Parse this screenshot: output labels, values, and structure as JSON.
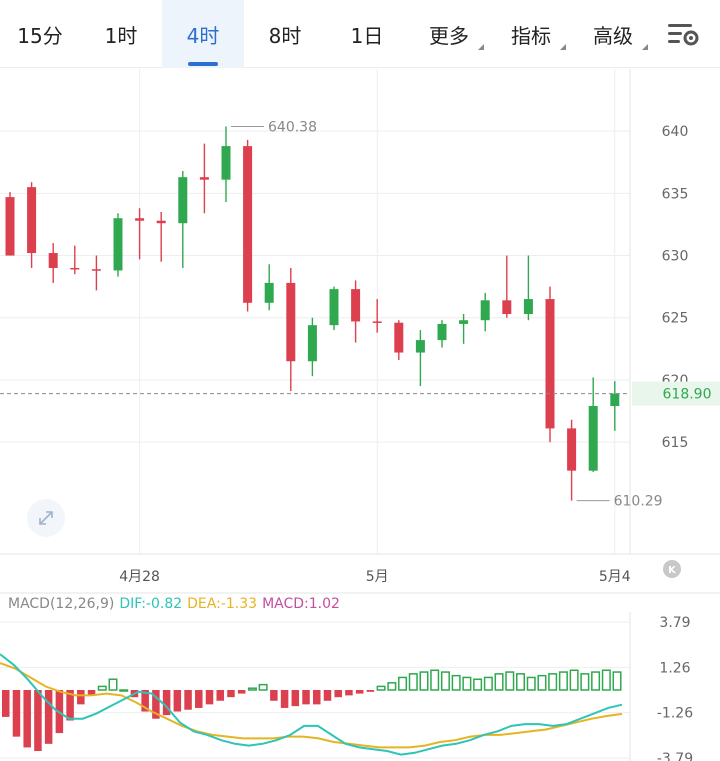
{
  "tabs": [
    {
      "label": "15分",
      "active": false,
      "dropdown": false
    },
    {
      "label": "1时",
      "active": false,
      "dropdown": false
    },
    {
      "label": "4时",
      "active": true,
      "dropdown": false
    },
    {
      "label": "8时",
      "active": false,
      "dropdown": false
    },
    {
      "label": "1日",
      "active": false,
      "dropdown": false
    },
    {
      "label": "更多",
      "active": false,
      "dropdown": true
    },
    {
      "label": "指标",
      "active": false,
      "dropdown": true
    },
    {
      "label": "高级",
      "active": false,
      "dropdown": true
    }
  ],
  "settings_icon": "chart-settings-icon",
  "zoom_icon": "expand-icon",
  "kline_badge": "K",
  "colors": {
    "up": "#2fa84f",
    "down": "#dc3f4d",
    "dif": "#2ec4b6",
    "dea": "#e6b422",
    "macd": "#c44fa0",
    "accent": "#2d6fd0",
    "grid": "#eeeeee",
    "price_badge_bg": "#e8f6ec",
    "price_badge_text": "#2fa84f"
  },
  "chart_data": [
    {
      "type": "candlestick",
      "ylim": [
        606,
        645
      ],
      "yticks": [
        615,
        620,
        625,
        630,
        635,
        640
      ],
      "x_labels": [
        {
          "label": "4月28",
          "index": 6
        },
        {
          "label": "5月",
          "index": 17
        },
        {
          "label": "5月4",
          "index": 28
        }
      ],
      "current_price": "618.90",
      "max_label": "640.38",
      "min_label": "610.29",
      "candles": [
        {
          "o": 634.7,
          "h": 635.1,
          "l": 630.0,
          "c": 630.0
        },
        {
          "o": 635.5,
          "h": 635.9,
          "l": 629.0,
          "c": 630.2
        },
        {
          "o": 630.2,
          "h": 631.0,
          "l": 627.8,
          "c": 629.0
        },
        {
          "o": 629.0,
          "h": 630.8,
          "l": 628.5,
          "c": 628.9
        },
        {
          "o": 628.9,
          "h": 630.0,
          "l": 627.2,
          "c": 628.8
        },
        {
          "o": 628.8,
          "h": 633.4,
          "l": 628.3,
          "c": 633.0
        },
        {
          "o": 633.0,
          "h": 633.8,
          "l": 629.7,
          "c": 632.8
        },
        {
          "o": 632.8,
          "h": 633.5,
          "l": 629.5,
          "c": 632.6
        },
        {
          "o": 632.6,
          "h": 636.8,
          "l": 629.0,
          "c": 636.3
        },
        {
          "o": 636.3,
          "h": 639.0,
          "l": 633.4,
          "c": 636.1
        },
        {
          "o": 636.1,
          "h": 640.38,
          "l": 634.3,
          "c": 638.8
        },
        {
          "o": 638.8,
          "h": 639.3,
          "l": 625.5,
          "c": 626.2
        },
        {
          "o": 626.2,
          "h": 629.3,
          "l": 625.6,
          "c": 627.8
        },
        {
          "o": 627.8,
          "h": 629.0,
          "l": 619.1,
          "c": 621.5
        },
        {
          "o": 621.5,
          "h": 625.0,
          "l": 620.3,
          "c": 624.4
        },
        {
          "o": 624.4,
          "h": 627.5,
          "l": 624.0,
          "c": 627.3
        },
        {
          "o": 627.3,
          "h": 628.0,
          "l": 623.0,
          "c": 624.7
        },
        {
          "o": 624.7,
          "h": 626.5,
          "l": 623.8,
          "c": 624.6
        },
        {
          "o": 624.6,
          "h": 624.8,
          "l": 621.6,
          "c": 622.2
        },
        {
          "o": 622.2,
          "h": 624.0,
          "l": 619.5,
          "c": 623.2
        },
        {
          "o": 623.2,
          "h": 624.8,
          "l": 622.6,
          "c": 624.5
        },
        {
          "o": 624.5,
          "h": 625.3,
          "l": 622.9,
          "c": 624.8
        },
        {
          "o": 624.8,
          "h": 627.0,
          "l": 623.9,
          "c": 626.4
        },
        {
          "o": 626.4,
          "h": 630.0,
          "l": 625.0,
          "c": 625.3
        },
        {
          "o": 625.3,
          "h": 630.0,
          "l": 624.8,
          "c": 626.5
        },
        {
          "o": 626.5,
          "h": 627.5,
          "l": 615.0,
          "c": 616.1
        },
        {
          "o": 616.1,
          "h": 616.8,
          "l": 610.29,
          "c": 612.7
        },
        {
          "o": 612.7,
          "h": 620.2,
          "l": 612.6,
          "c": 617.9
        },
        {
          "o": 617.9,
          "h": 619.9,
          "l": 615.9,
          "c": 618.9
        }
      ]
    },
    {
      "type": "macd",
      "params": "MACD(12,26,9)",
      "dif_label": "DIF:",
      "dif": "-0.82",
      "dea_label": "DEA:",
      "dea": "-1.33",
      "macd_label": "MACD:",
      "macd": "1.02",
      "ylim": [
        -3.79,
        3.79
      ],
      "yticks": [
        "3.79",
        "1.26",
        "-1.26",
        "-3.79"
      ],
      "hist": [
        -1.5,
        -2.6,
        -3.2,
        -3.4,
        -3.0,
        -2.4,
        -1.7,
        -0.8,
        -0.3,
        0.2,
        0.6,
        0.0,
        -0.4,
        -1.2,
        -1.6,
        -1.4,
        -1.2,
        -1.1,
        -1.0,
        -0.8,
        -0.6,
        -0.4,
        -0.2,
        0.1,
        0.3,
        -0.6,
        -1.0,
        -0.9,
        -0.8,
        -0.8,
        -0.6,
        -0.4,
        -0.3,
        -0.2,
        -0.1,
        0.2,
        0.4,
        0.7,
        0.9,
        1.0,
        1.1,
        1.0,
        0.8,
        0.7,
        0.6,
        0.7,
        0.9,
        1.0,
        0.9,
        0.7,
        0.8,
        0.9,
        1.0,
        1.1,
        0.9,
        1.0,
        1.1,
        1.0
      ],
      "dif_values": [
        2.0,
        1.4,
        0.6,
        -0.3,
        -1.1,
        -1.6,
        -1.6,
        -1.3,
        -0.9,
        -0.5,
        -0.1,
        -0.2,
        -0.9,
        -1.8,
        -2.3,
        -2.5,
        -2.8,
        -3.0,
        -3.1,
        -3.0,
        -2.8,
        -2.5,
        -2.0,
        -2.0,
        -2.5,
        -3.0,
        -3.2,
        -3.3,
        -3.4,
        -3.6,
        -3.5,
        -3.3,
        -3.1,
        -3.0,
        -2.8,
        -2.5,
        -2.3,
        -2.0,
        -1.9,
        -1.9,
        -2.0,
        -1.9,
        -1.6,
        -1.3,
        -1.0,
        -0.82
      ],
      "dea_values": [
        1.5,
        1.2,
        0.7,
        0.2,
        -0.1,
        -0.3,
        -0.3,
        -0.2,
        -0.3,
        -0.7,
        -1.2,
        -1.6,
        -2.0,
        -2.3,
        -2.5,
        -2.6,
        -2.7,
        -2.7,
        -2.7,
        -2.6,
        -2.6,
        -2.7,
        -2.9,
        -3.0,
        -3.1,
        -3.2,
        -3.2,
        -3.2,
        -3.1,
        -2.9,
        -2.8,
        -2.6,
        -2.5,
        -2.5,
        -2.4,
        -2.3,
        -2.2,
        -2.0,
        -1.8,
        -1.6,
        -1.45,
        -1.33
      ]
    }
  ]
}
